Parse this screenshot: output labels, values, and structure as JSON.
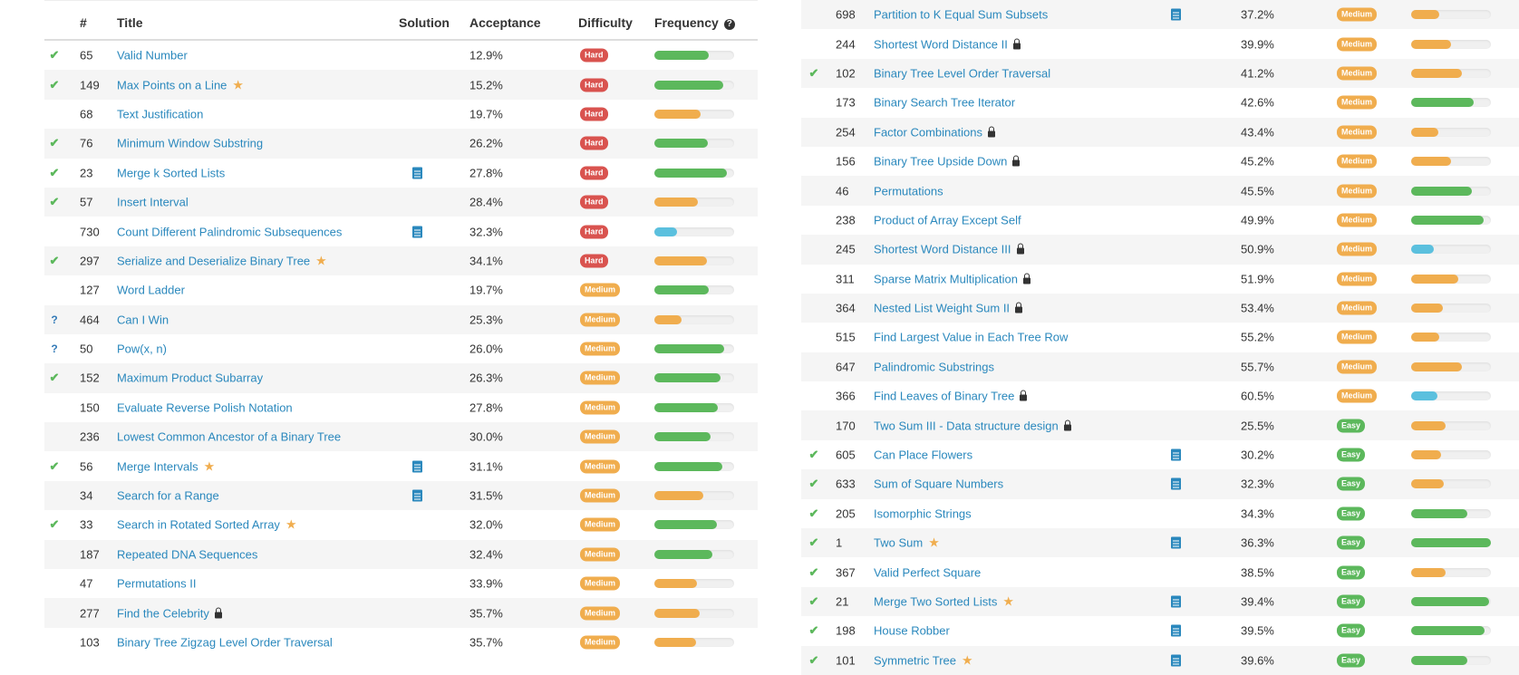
{
  "header": {
    "num": "#",
    "title": "Title",
    "solution": "Solution",
    "acceptance": "Acceptance",
    "difficulty": "Difficulty",
    "frequency": "Frequency",
    "help_glyph": "?"
  },
  "colors": {
    "link": "#2a88bd",
    "accepted": "#5cb85c",
    "hard": "#d9534f",
    "medium": "#f0ad4e",
    "easy": "#5cb85c",
    "freq_blue": "#5bc0de"
  },
  "left_rows": [
    {
      "status": "ac",
      "num": "65",
      "title": "Valid Number",
      "acc": "12.9%",
      "diff": "Hard",
      "freq": 0.68,
      "color": "g"
    },
    {
      "status": "ac",
      "num": "149",
      "title": "Max Points on a Line",
      "star": true,
      "acc": "15.2%",
      "diff": "Hard",
      "freq": 0.86,
      "color": "g"
    },
    {
      "status": "",
      "num": "68",
      "title": "Text Justification",
      "acc": "19.7%",
      "diff": "Hard",
      "freq": 0.58,
      "color": "o"
    },
    {
      "status": "ac",
      "num": "76",
      "title": "Minimum Window Substring",
      "acc": "26.2%",
      "diff": "Hard",
      "freq": 0.67,
      "color": "g"
    },
    {
      "status": "ac",
      "num": "23",
      "title": "Merge k Sorted Lists",
      "sol": true,
      "acc": "27.8%",
      "diff": "Hard",
      "freq": 0.91,
      "color": "g"
    },
    {
      "status": "ac",
      "num": "57",
      "title": "Insert Interval",
      "acc": "28.4%",
      "diff": "Hard",
      "freq": 0.55,
      "color": "o"
    },
    {
      "status": "",
      "num": "730",
      "title": "Count Different Palindromic Subsequences",
      "sol": true,
      "acc": "32.3%",
      "diff": "Hard",
      "freq": 0.28,
      "color": "b"
    },
    {
      "status": "ac",
      "num": "297",
      "title": "Serialize and Deserialize Binary Tree",
      "star": true,
      "acc": "34.1%",
      "diff": "Hard",
      "freq": 0.66,
      "color": "o"
    },
    {
      "status": "",
      "num": "127",
      "title": "Word Ladder",
      "acc": "19.7%",
      "diff": "Medium",
      "freq": 0.68,
      "color": "g"
    },
    {
      "status": "q",
      "num": "464",
      "title": "Can I Win",
      "acc": "25.3%",
      "diff": "Medium",
      "freq": 0.34,
      "color": "o"
    },
    {
      "status": "q",
      "num": "50",
      "title": "Pow(x, n)",
      "acc": "26.0%",
      "diff": "Medium",
      "freq": 0.87,
      "color": "g"
    },
    {
      "status": "ac",
      "num": "152",
      "title": "Maximum Product Subarray",
      "acc": "26.3%",
      "diff": "Medium",
      "freq": 0.83,
      "color": "g"
    },
    {
      "status": "",
      "num": "150",
      "title": "Evaluate Reverse Polish Notation",
      "acc": "27.8%",
      "diff": "Medium",
      "freq": 0.8,
      "color": "g"
    },
    {
      "status": "",
      "num": "236",
      "title": "Lowest Common Ancestor of a Binary Tree",
      "acc": "30.0%",
      "diff": "Medium",
      "freq": 0.7,
      "color": "g"
    },
    {
      "status": "ac",
      "num": "56",
      "title": "Merge Intervals",
      "star": true,
      "sol": true,
      "acc": "31.1%",
      "diff": "Medium",
      "freq": 0.85,
      "color": "g"
    },
    {
      "status": "",
      "num": "34",
      "title": "Search for a Range",
      "sol": true,
      "acc": "31.5%",
      "diff": "Medium",
      "freq": 0.61,
      "color": "o"
    },
    {
      "status": "ac",
      "num": "33",
      "title": "Search in Rotated Sorted Array",
      "star": true,
      "acc": "32.0%",
      "diff": "Medium",
      "freq": 0.78,
      "color": "g"
    },
    {
      "status": "",
      "num": "187",
      "title": "Repeated DNA Sequences",
      "acc": "32.4%",
      "diff": "Medium",
      "freq": 0.73,
      "color": "g"
    },
    {
      "status": "",
      "num": "47",
      "title": "Permutations II",
      "acc": "33.9%",
      "diff": "Medium",
      "freq": 0.53,
      "color": "o"
    },
    {
      "status": "",
      "num": "277",
      "title": "Find the Celebrity",
      "lock": true,
      "acc": "35.7%",
      "diff": "Medium",
      "freq": 0.57,
      "color": "o"
    },
    {
      "status": "",
      "num": "103",
      "title": "Binary Tree Zigzag Level Order Traversal",
      "acc": "35.7%",
      "diff": "Medium",
      "freq": 0.52,
      "color": "o"
    }
  ],
  "right_rows": [
    {
      "status": "",
      "num": "698",
      "title": "Partition to K Equal Sum Subsets",
      "sol": true,
      "acc": "37.2%",
      "diff": "Medium",
      "freq": 0.35,
      "color": "o"
    },
    {
      "status": "",
      "num": "244",
      "title": "Shortest Word Distance II",
      "lock": true,
      "acc": "39.9%",
      "diff": "Medium",
      "freq": 0.5,
      "color": "o"
    },
    {
      "status": "ac",
      "num": "102",
      "title": "Binary Tree Level Order Traversal",
      "acc": "41.2%",
      "diff": "Medium",
      "freq": 0.64,
      "color": "o"
    },
    {
      "status": "",
      "num": "173",
      "title": "Binary Search Tree Iterator",
      "acc": "42.6%",
      "diff": "Medium",
      "freq": 0.78,
      "color": "g"
    },
    {
      "status": "",
      "num": "254",
      "title": "Factor Combinations",
      "lock": true,
      "acc": "43.4%",
      "diff": "Medium",
      "freq": 0.34,
      "color": "o"
    },
    {
      "status": "",
      "num": "156",
      "title": "Binary Tree Upside Down",
      "lock": true,
      "acc": "45.2%",
      "diff": "Medium",
      "freq": 0.5,
      "color": "o"
    },
    {
      "status": "",
      "num": "46",
      "title": "Permutations",
      "acc": "45.5%",
      "diff": "Medium",
      "freq": 0.76,
      "color": "g"
    },
    {
      "status": "",
      "num": "238",
      "title": "Product of Array Except Self",
      "acc": "49.9%",
      "diff": "Medium",
      "freq": 0.91,
      "color": "g"
    },
    {
      "status": "",
      "num": "245",
      "title": "Shortest Word Distance III",
      "lock": true,
      "acc": "50.9%",
      "diff": "Medium",
      "freq": 0.28,
      "color": "b"
    },
    {
      "status": "",
      "num": "311",
      "title": "Sparse Matrix Multiplication",
      "lock": true,
      "acc": "51.9%",
      "diff": "Medium",
      "freq": 0.59,
      "color": "o"
    },
    {
      "status": "",
      "num": "364",
      "title": "Nested List Weight Sum II",
      "lock": true,
      "acc": "53.4%",
      "diff": "Medium",
      "freq": 0.4,
      "color": "o"
    },
    {
      "status": "",
      "num": "515",
      "title": "Find Largest Value in Each Tree Row",
      "acc": "55.2%",
      "diff": "Medium",
      "freq": 0.35,
      "color": "o"
    },
    {
      "status": "",
      "num": "647",
      "title": "Palindromic Substrings",
      "acc": "55.7%",
      "diff": "Medium",
      "freq": 0.64,
      "color": "o"
    },
    {
      "status": "",
      "num": "366",
      "title": "Find Leaves of Binary Tree",
      "lock": true,
      "acc": "60.5%",
      "diff": "Medium",
      "freq": 0.33,
      "color": "b"
    },
    {
      "status": "",
      "num": "170",
      "title": "Two Sum III - Data structure design",
      "lock": true,
      "acc": "25.5%",
      "diff": "Easy",
      "freq": 0.43,
      "color": "o"
    },
    {
      "status": "ac",
      "num": "605",
      "title": "Can Place Flowers",
      "sol": true,
      "acc": "30.2%",
      "diff": "Easy",
      "freq": 0.37,
      "color": "o"
    },
    {
      "status": "ac",
      "num": "633",
      "title": "Sum of Square Numbers",
      "sol": true,
      "acc": "32.3%",
      "diff": "Easy",
      "freq": 0.41,
      "color": "o"
    },
    {
      "status": "ac",
      "num": "205",
      "title": "Isomorphic Strings",
      "acc": "34.3%",
      "diff": "Easy",
      "freq": 0.7,
      "color": "g"
    },
    {
      "status": "ac",
      "num": "1",
      "title": "Two Sum",
      "star": true,
      "sol": true,
      "acc": "36.3%",
      "diff": "Easy",
      "freq": 1.0,
      "color": "g"
    },
    {
      "status": "ac",
      "num": "367",
      "title": "Valid Perfect Square",
      "acc": "38.5%",
      "diff": "Easy",
      "freq": 0.43,
      "color": "o"
    },
    {
      "status": "ac",
      "num": "21",
      "title": "Merge Two Sorted Lists",
      "star": true,
      "sol": true,
      "acc": "39.4%",
      "diff": "Easy",
      "freq": 0.98,
      "color": "g"
    },
    {
      "status": "ac",
      "num": "198",
      "title": "House Robber",
      "sol": true,
      "acc": "39.5%",
      "diff": "Easy",
      "freq": 0.92,
      "color": "g"
    },
    {
      "status": "ac",
      "num": "101",
      "title": "Symmetric Tree",
      "star": true,
      "sol": true,
      "acc": "39.6%",
      "diff": "Easy",
      "freq": 0.7,
      "color": "g"
    }
  ]
}
